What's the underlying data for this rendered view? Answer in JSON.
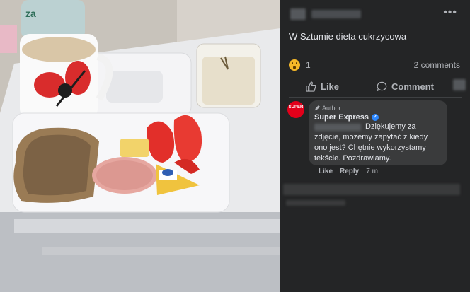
{
  "post": {
    "text": "W Sztumie dieta cukrzycowa",
    "reaction_count": "1",
    "comments_count": "2 comments"
  },
  "actions": {
    "like": "Like",
    "comment": "Comment"
  },
  "comment": {
    "author_tag": "Author",
    "author_name": "Super Express",
    "avatar_text": "SUPER",
    "text": "Dziękujemy za zdjęcie, możemy zapytać z kiedy ono jest? Chętnie wykorzystamy tekście. Pozdrawiamy.",
    "like": "Like",
    "reply": "Reply",
    "time": "7 m"
  },
  "icons": {
    "more": "more-dots-icon",
    "reaction": "wow-reaction-icon",
    "like": "thumbs-up-icon",
    "comment": "speech-bubble-icon",
    "verified": "verified-badge-icon",
    "author": "pencil-icon"
  },
  "colors": {
    "background": "#18191a",
    "panel": "#242526",
    "bubble": "#3a3b3c",
    "verified": "#2d88ff",
    "brand": "#e2001a",
    "reaction": "#f7b928"
  }
}
